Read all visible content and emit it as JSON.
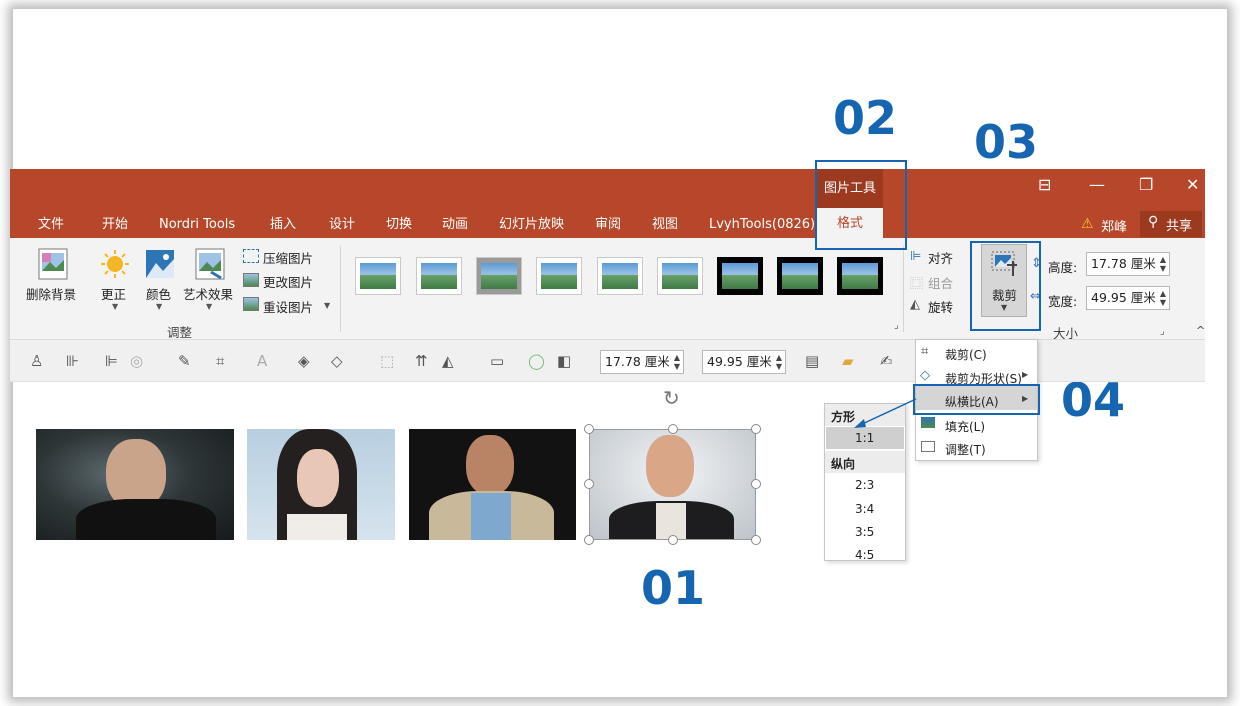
{
  "steps": {
    "s01": "01",
    "s02": "02",
    "s03": "03",
    "s04": "04"
  },
  "titlebar": {
    "context_group": "图片工具",
    "user": "郑峰",
    "share": "共享"
  },
  "tabs": [
    "文件",
    "开始",
    "Nordri Tools",
    "插入",
    "设计",
    "切换",
    "动画",
    "幻灯片放映",
    "审阅",
    "视图",
    "LvyhTools(0826)"
  ],
  "active_tab": "格式",
  "ribbon": {
    "remove_bg": "删除背景",
    "corrections": "更正",
    "color": "颜色",
    "art_effects": "艺术效果",
    "compress": "压缩图片",
    "change": "更改图片",
    "reset": "重设图片",
    "adjust_group": "调整",
    "align": "对齐",
    "group": "组合",
    "rotate": "旋转",
    "crop": "裁剪",
    "height_label": "高度:",
    "height_value": "17.78 厘米",
    "width_label": "宽度:",
    "width_value": "49.95 厘米",
    "size_group": "大小"
  },
  "qat": {
    "height_value": "17.78 厘米",
    "width_value": "49.95 厘米"
  },
  "crop_menu": {
    "crop": "裁剪(C)",
    "crop_to_shape": "裁剪为形状(S)",
    "aspect_ratio": "纵横比(A)",
    "fill": "填充(L)",
    "fit": "调整(T)"
  },
  "aspect_menu": {
    "square_header": "方形",
    "square": [
      "1:1"
    ],
    "portrait_header": "纵向",
    "portrait": [
      "2:3",
      "3:4",
      "3:5",
      "4:5"
    ]
  },
  "colors": {
    "accent": "#b7472a",
    "highlight": "#1565b0"
  }
}
